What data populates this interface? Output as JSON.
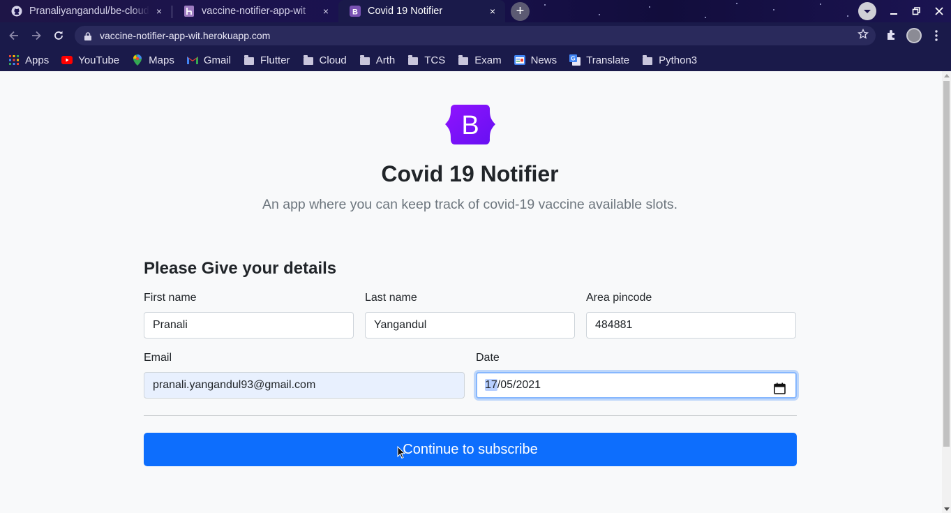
{
  "browser": {
    "tabs": [
      {
        "title": "Pranaliyangandul/be-cloud",
        "icon": "github-icon",
        "close": "×"
      },
      {
        "title": "vaccine-notifier-app-wit",
        "icon": "heroku-icon",
        "close": "×"
      },
      {
        "title": "Covid 19 Notifier",
        "icon": "bootstrap-icon",
        "close": "×",
        "active": true
      }
    ],
    "new_tab": "+",
    "url": "vaccine-notifier-app-wit.herokuapp.com",
    "bookmarks": [
      {
        "label": "Apps",
        "icon": "apps-grid-icon"
      },
      {
        "label": "YouTube",
        "icon": "youtube-icon"
      },
      {
        "label": "Maps",
        "icon": "maps-pin-icon"
      },
      {
        "label": "Gmail",
        "icon": "gmail-icon"
      },
      {
        "label": "Flutter",
        "icon": "folder-icon"
      },
      {
        "label": "Cloud",
        "icon": "folder-icon"
      },
      {
        "label": "Arth",
        "icon": "folder-icon"
      },
      {
        "label": "TCS",
        "icon": "folder-icon"
      },
      {
        "label": "Exam",
        "icon": "folder-icon"
      },
      {
        "label": "News",
        "icon": "google-news-icon"
      },
      {
        "label": "Translate",
        "icon": "google-translate-icon"
      },
      {
        "label": "Python3",
        "icon": "folder-icon"
      }
    ]
  },
  "page": {
    "logo_letter": "B",
    "title": "Covid 19 Notifier",
    "lead": "An app where you can keep track of covid-19 vaccine available slots.",
    "form": {
      "heading": "Please Give your details",
      "first_name": {
        "label": "First name",
        "value": "Pranali"
      },
      "last_name": {
        "label": "Last name",
        "value": "Yangandul"
      },
      "pincode": {
        "label": "Area pincode",
        "value": "484881"
      },
      "email": {
        "label": "Email",
        "value": "pranali.yangandul93@gmail.com"
      },
      "date": {
        "label": "Date",
        "day": "17",
        "rest": "/05/2021"
      },
      "submit": "Continue to subscribe"
    }
  },
  "colors": {
    "primary": "#0d6efd",
    "bootstrap_purple": "#7952b3",
    "chrome_bg": "#1a1a4a"
  }
}
